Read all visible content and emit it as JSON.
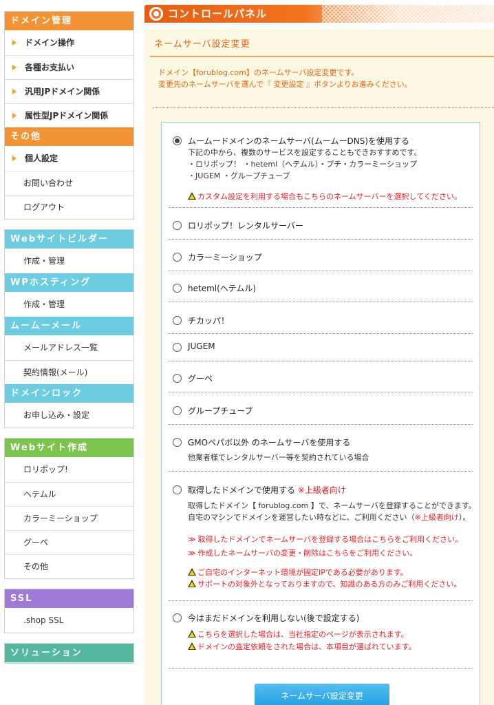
{
  "sidebar": {
    "groups": [
      {
        "heading": "ドメイン管理",
        "color": "#f29435",
        "items": [
          {
            "label": "ドメイン操作",
            "bold": true
          },
          {
            "label": "各種お支払い",
            "bold": true
          },
          {
            "label": "汎用JPドメイン関係",
            "bold": true
          },
          {
            "label": "属性型JPドメイン関係",
            "bold": true
          }
        ]
      },
      {
        "heading": "その他",
        "color": "#f29435",
        "items": [
          {
            "label": "個人設定",
            "bold": true
          },
          {
            "label": "お問い合わせ",
            "bold": false
          },
          {
            "label": "ログアウト",
            "bold": false
          }
        ]
      }
    ],
    "group2": [
      {
        "heading": "Webサイトビルダー",
        "color": "#6ccce0",
        "items": [
          {
            "label": "作成・管理"
          }
        ]
      },
      {
        "heading": "WPホスティング",
        "color": "#6ccce0",
        "items": [
          {
            "label": "作成・管理"
          }
        ]
      },
      {
        "heading": "ムームーメール",
        "color": "#6ccce0",
        "items": [
          {
            "label": "メールアドレス一覧"
          },
          {
            "label": "契約情報(メール)"
          }
        ]
      },
      {
        "heading": "ドメインロック",
        "color": "#6ccce0",
        "items": [
          {
            "label": "お申し込み・設定"
          }
        ]
      }
    ],
    "group3": {
      "heading": "Webサイト作成",
      "color": "#7cc44e",
      "items": [
        {
          "label": "ロリポップ!"
        },
        {
          "label": "ヘテムル"
        },
        {
          "label": "カラーミーショップ"
        },
        {
          "label": "グーペ"
        },
        {
          "label": "その他"
        }
      ]
    },
    "group4": {
      "heading": "SSL",
      "color": "#a07ad6",
      "items": [
        {
          "label": ".shop SSL"
        }
      ]
    },
    "group5": {
      "heading": "ソリューション",
      "color": "#56b7a0"
    }
  },
  "header": {
    "title": "コントロールパネル"
  },
  "main": {
    "page_title": "ネームサーバ設定変更",
    "intro_line1": "ドメイン【forublog.com】のネームサーバ設定変更です。",
    "intro_line2": "変更先のネームサーバを選んで『 変更設定 』ボタンよりお進みください。"
  },
  "options": {
    "muumuu": {
      "label": "ムームードメインのネームサーバ(ムームーDNS)を使用する",
      "sub1": "下記の中から、複数のサービスを設定することもできおすすめです。",
      "sub2": "・ロリポップ！ ・heteml（ヘテムル）・プチ・カラーミーショップ",
      "sub3": "・JUGEM ・グループチューブ",
      "warn_hl": "カスタム設定",
      "warn_rest": "を利用する場合もこちらのネームサーバーを選択してください。"
    },
    "lolipop": {
      "label": "ロリポップ！レンタルサーバー"
    },
    "colorme": {
      "label": "カラーミーショップ"
    },
    "heteml": {
      "label": "heteml(ヘテムル)"
    },
    "chikappa": {
      "label": "チカッパ！"
    },
    "jugem": {
      "label": "JUGEM"
    },
    "goope": {
      "label": "グーペ"
    },
    "grouptube": {
      "label": "グループチューブ"
    },
    "other": {
      "label": "GMOペパボ以外 のネームサーバを使用する",
      "sub": "他業者様でレンタルサーバー等を契約されている場合"
    },
    "own": {
      "label": "取得したドメインで使用する",
      "label_hl": "※上級者向け",
      "sub1": "取得したドメイン【 forublog.com 】で、ネームサーバを登録することができます。",
      "sub2a": "自宅のマシンでドメインを運営したい時などに、ご利用ください（",
      "sub2b": "※上級者向け",
      "sub2c": "）。",
      "link1": "取得したドメインでネームサーバを登録する場合はこちらをご利用ください。",
      "link2": "作成したネームサーバの変更・削除はこちらをご利用ください。",
      "warn1": "ご自宅のインターネット環境が固定IPである必要があります。",
      "warn2": "サポートの対象外となっておりますので、知識のある方のみご利用ください。"
    },
    "later": {
      "label": "今はまだドメインを利用しない(後で設定する)",
      "warn1": "こちらを選択した場合は、当社指定のページが表示されます。",
      "warn2": "ドメインの査定依頼をされた場合は、本項目が選ばれています。"
    }
  },
  "submit_label": "ネームサーバ設定変更"
}
